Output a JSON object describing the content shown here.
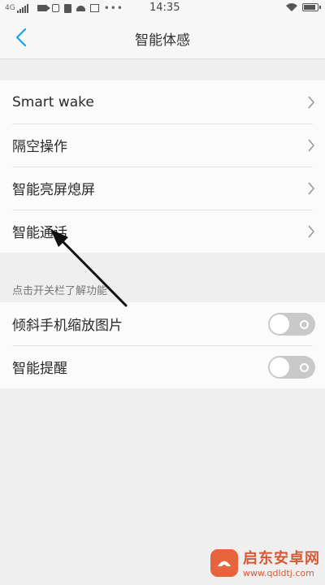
{
  "status_bar": {
    "network": "4G",
    "time": "14:35",
    "more": "•••",
    "icons": [
      "signal-icon",
      "video-icon",
      "box-icon",
      "doc-icon",
      "android-icon",
      "image-icon",
      "wifi-icon",
      "battery-icon"
    ]
  },
  "header": {
    "back_icon": "chevron-left-icon",
    "title": "智能体感"
  },
  "menu_items": [
    {
      "label": "Smart wake"
    },
    {
      "label": "隔空操作"
    },
    {
      "label": "智能亮屏熄屏"
    },
    {
      "label": "智能通话"
    }
  ],
  "section_hint": "点击开关栏了解功能",
  "toggle_items": [
    {
      "label": "倾斜手机缩放图片",
      "enabled": false
    },
    {
      "label": "智能提醒",
      "enabled": false
    }
  ],
  "watermark": {
    "name": "启东安卓网",
    "url": "www.qdldtj.com"
  },
  "colors": {
    "accent": "#1aa3e8",
    "background": "#efefef",
    "row_background": "#fbfbfb",
    "toggle_off": "#c9c9c9",
    "watermark": "#d45a36"
  }
}
